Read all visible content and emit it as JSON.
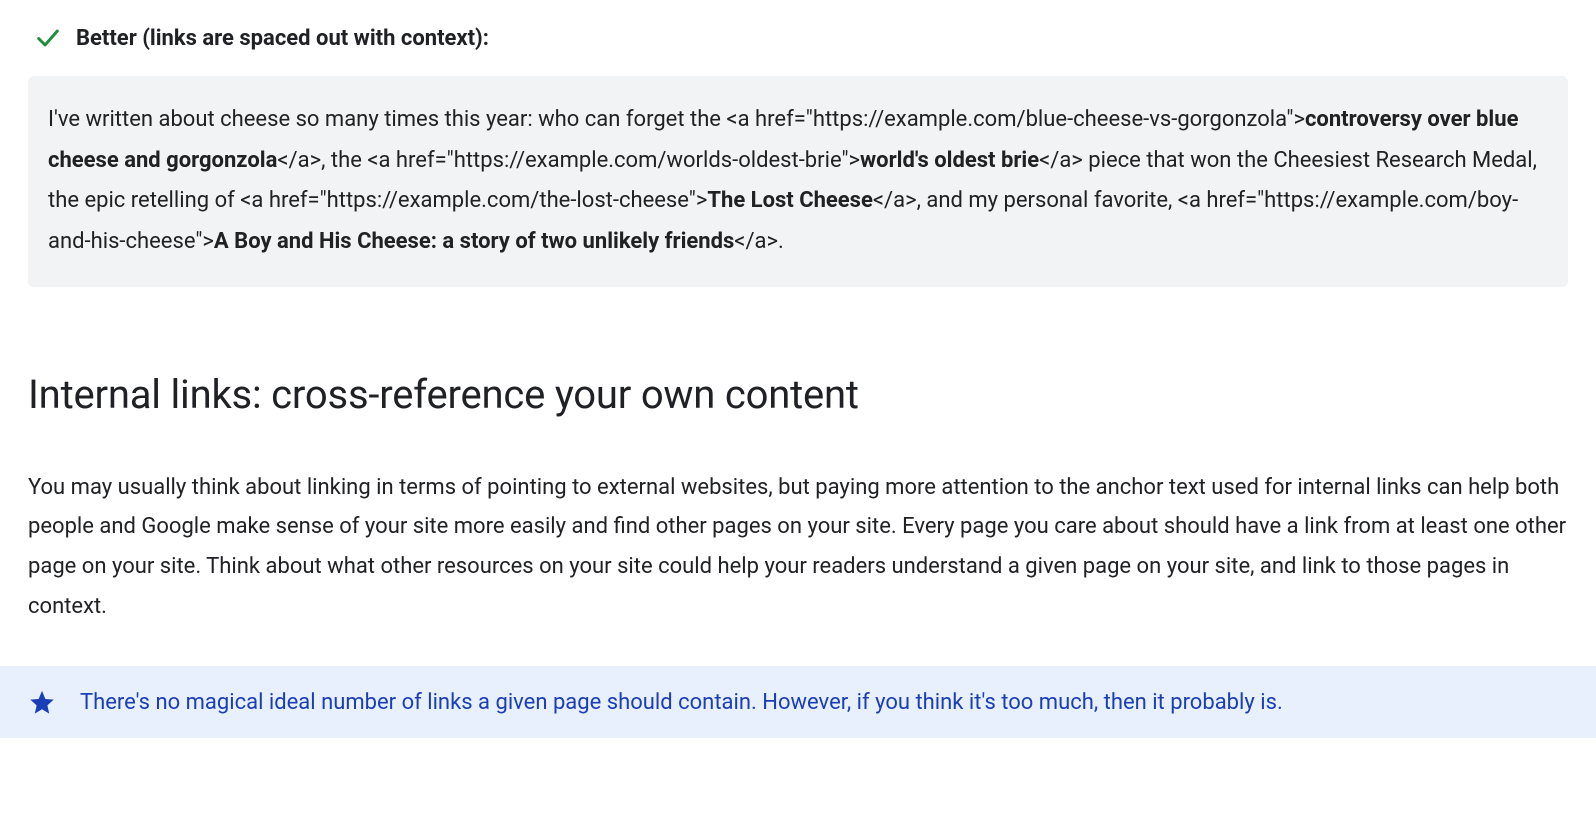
{
  "better": {
    "label": "Better (links are spaced out with context):"
  },
  "code": {
    "t1": "I've written about cheese so many times this year: who can forget the <a href=\"https://example.com/blue-cheese-vs-gorgonzola\">",
    "link1": "controversy over blue cheese and gorgonzola",
    "t2": "</a>, the <a href=\"https://example.com/worlds-oldest-brie\">",
    "link2": "world's oldest brie",
    "t3": "</a> piece that won the Cheesiest Research Medal, the epic retelling of <a href=\"https://example.com/the-lost-cheese\">",
    "link3": "The Lost Cheese",
    "t4": "</a>, and my personal favorite, <a href=\"https://example.com/boy-and-his-cheese\">",
    "link4": "A Boy and His Cheese: a story of two unlikely friends",
    "t5": "</a>."
  },
  "section": {
    "heading": "Internal links: cross-reference your own content",
    "body": "You may usually think about linking in terms of pointing to external websites, but paying more attention to the anchor text used for internal links can help both people and Google make sense of your site more easily and find other pages on your site. Every page you care about should have a link from at least one other page on your site. Think about what other resources on your site could help your readers understand a given page on your site, and link to those pages in context."
  },
  "note": {
    "text": "There's no magical ideal number of links a given page should contain. However, if you think it's too much, then it probably is."
  }
}
